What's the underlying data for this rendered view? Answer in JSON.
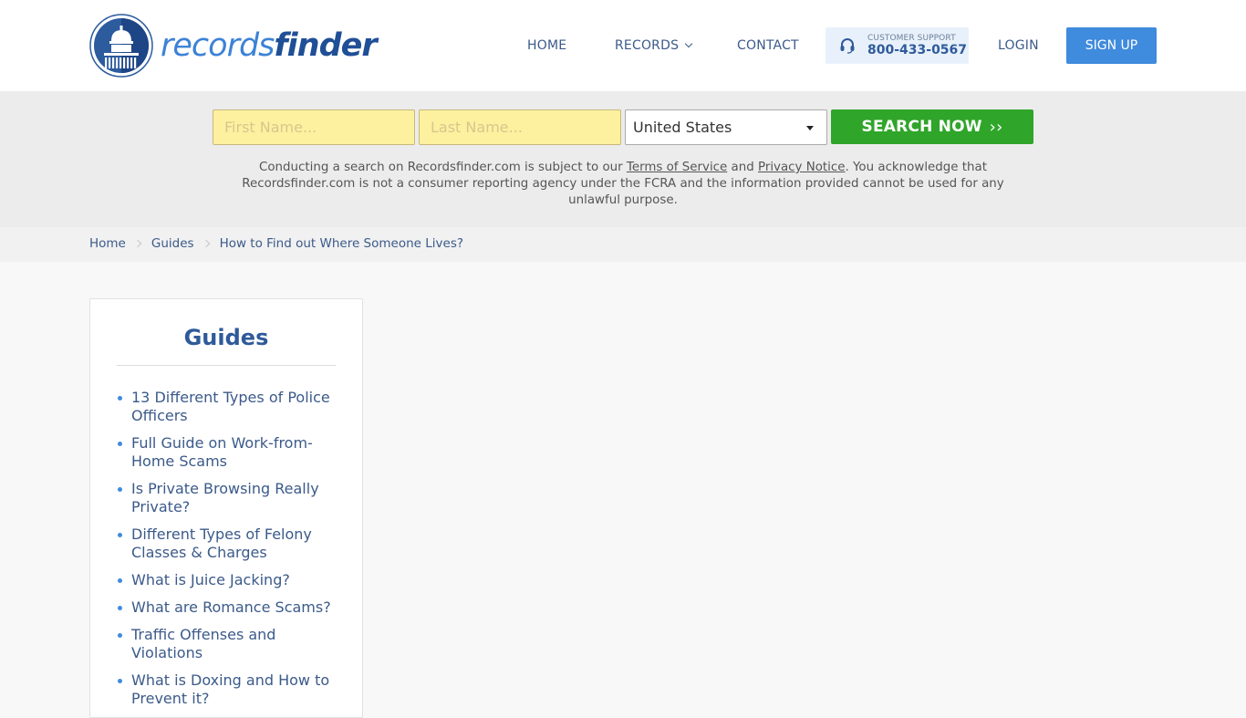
{
  "header": {
    "logo": {
      "part1": "records",
      "part2": "finder"
    },
    "nav": {
      "home": "HOME",
      "records": "RECORDS",
      "contact": "CONTACT",
      "login": "LOGIN",
      "signup": "SIGN UP"
    },
    "support": {
      "label": "CUSTOMER SUPPORT",
      "phone": "800-433-0567"
    }
  },
  "search": {
    "first_name_placeholder": "First Name...",
    "last_name_placeholder": "Last Name...",
    "country": "United States",
    "button": "SEARCH NOW",
    "button_icon": "››",
    "disclaimer": {
      "pre": "Conducting a search on Recordsfinder.com is subject to our ",
      "terms": "Terms of Service",
      "and": " and ",
      "privacy": "Privacy Notice",
      "post": ". You acknowledge that Recordsfinder.com is not a consumer reporting agency under the FCRA and the information provided cannot be used for any unlawful purpose."
    }
  },
  "breadcrumb": [
    {
      "label": "Home"
    },
    {
      "label": "Guides"
    },
    {
      "label": "How to Find out Where Someone Lives?"
    }
  ],
  "sidebar": {
    "title": "Guides",
    "items": [
      "13 Different Types of Police Officers",
      "Full Guide on Work-from-Home Scams",
      "Is Private Browsing Really Private?",
      "Different Types of Felony Classes & Charges",
      "What is Juice Jacking?",
      "What are Romance Scams?",
      "Traffic Offenses and Violations",
      "What is Doxing and How to Prevent it?"
    ]
  },
  "colors": {
    "brand_dark": "#1f4f96",
    "brand_light": "#3d82d6",
    "signup_bg": "#3f8bdd",
    "search_btn_bg": "#2fa52a",
    "input_bg": "#fdf1a0",
    "link": "#3b5a8a"
  }
}
